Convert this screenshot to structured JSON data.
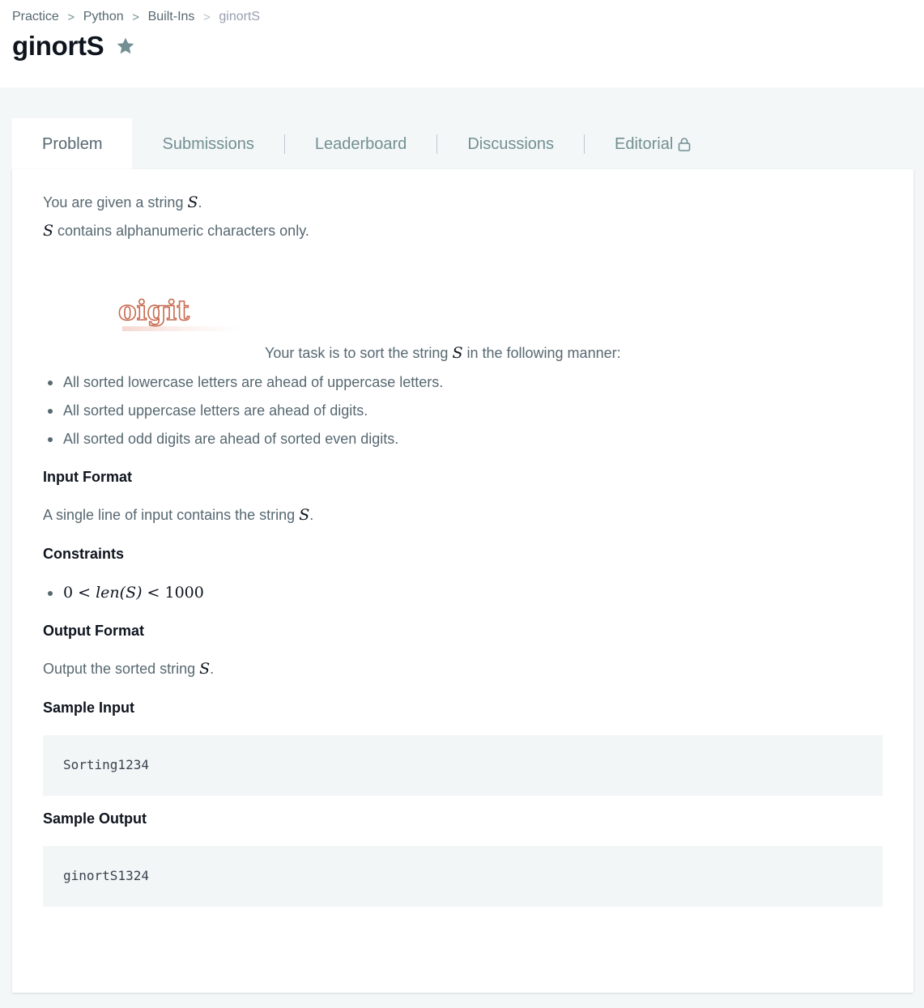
{
  "breadcrumb": {
    "items": [
      "Practice",
      "Python",
      "Built-Ins"
    ],
    "current": "ginortS",
    "separator": ">"
  },
  "header": {
    "title": "ginortS",
    "favorite_icon": "star-icon"
  },
  "tabs": {
    "items": [
      {
        "label": "Problem",
        "active": true
      },
      {
        "label": "Submissions",
        "active": false
      },
      {
        "label": "Leaderboard",
        "active": false
      },
      {
        "label": "Discussions",
        "active": false
      },
      {
        "label": "Editorial",
        "active": false,
        "icon": "lock-icon"
      }
    ]
  },
  "problem": {
    "intro_1_prefix": "You are given a string ",
    "intro_1_var": "S",
    "intro_1_suffix": ".",
    "intro_2_var": "S",
    "intro_2_suffix": " contains alphanumeric characters only.",
    "image_text": "oigit",
    "task_prefix": "Your task is to sort the string ",
    "task_var": "S",
    "task_suffix": " in the following manner:",
    "rules": [
      "All sorted lowercase letters are ahead of uppercase letters.",
      "All sorted uppercase letters are ahead of digits.",
      "All sorted odd digits are ahead of sorted even digits."
    ],
    "input_format_heading": "Input Format",
    "input_format_prefix": "A single line of input contains the string ",
    "input_format_var": "S",
    "input_format_suffix": ".",
    "constraints_heading": "Constraints",
    "constraint_lhs": "0 < ",
    "constraint_mid": "len(S)",
    "constraint_rhs": " < 1000",
    "output_format_heading": "Output Format",
    "output_format_prefix": "Output the sorted string ",
    "output_format_var": "S",
    "output_format_suffix": ".",
    "sample_input_heading": "Sample Input",
    "sample_input": "Sorting1234",
    "sample_output_heading": "Sample Output",
    "sample_output": "ginortS1324"
  },
  "colors": {
    "title": "#0e141e",
    "body_text": "#576871",
    "tab_text": "#738f93",
    "page_bg": "#f3f7f7",
    "code_bg": "#f3f6f7",
    "image_accent": "#c8694f"
  }
}
